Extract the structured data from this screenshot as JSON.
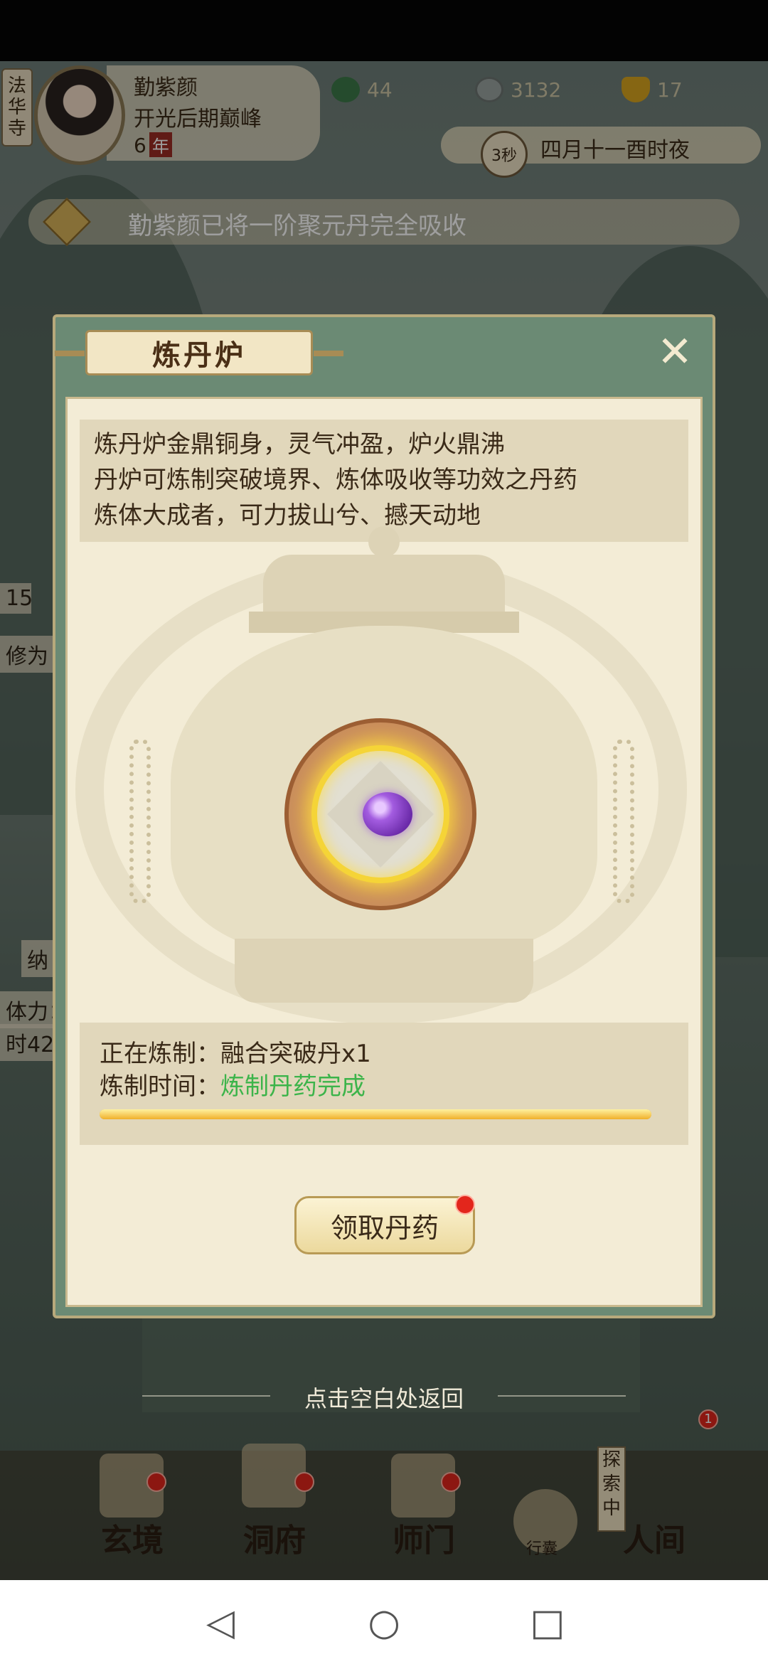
{
  "header": {
    "side_tag": "法华寺",
    "player_name": "勤紫颜",
    "realm": "开光后期巅峰",
    "age_value": "6",
    "age_unit": "年",
    "resources": [
      {
        "icon": "spirit-stone-icon",
        "value": "44"
      },
      {
        "icon": "coin-icon",
        "value": "3132"
      },
      {
        "icon": "ingot-icon",
        "value": "17"
      }
    ],
    "timer": "3秒",
    "date": "四月十一酉时夜"
  },
  "notice": {
    "text": "勤紫颜已将一阶聚元丹完全吸收"
  },
  "background_peek": {
    "level": "15",
    "cultivation_label": "修为",
    "na": "纳",
    "stamina": "体力：",
    "time": "时42"
  },
  "modal": {
    "title": "炼丹炉",
    "close_icon": "close-icon",
    "description": [
      "炼丹炉金鼎铜身，灵气冲盈，炉火鼎沸",
      "丹炉可炼制突破境界、炼体吸收等功效之丹药",
      "炼体大成者，可力拔山兮、撼天动地"
    ],
    "refining_label": "正在炼制：",
    "refining_item": "融合突破丹x1",
    "time_label": "炼制时间：",
    "time_status": "炼制丹药完成",
    "progress": 1.0,
    "claim_button": "领取丹药"
  },
  "hint": "点击空白处返回",
  "bottom_nav": {
    "items": [
      {
        "label": "玄境"
      },
      {
        "label": "洞府"
      },
      {
        "label": "师门"
      },
      {
        "label": "行囊"
      },
      {
        "label": "人间"
      }
    ],
    "explore_tag": "探索中",
    "badge_count": "1"
  },
  "colors": {
    "modal_frame": "#6b8a74",
    "panel_bg": "#f3ecd6",
    "status_green": "#3cb44a",
    "progress_gold": "#f0b02a",
    "alert_red": "#e3261c"
  }
}
